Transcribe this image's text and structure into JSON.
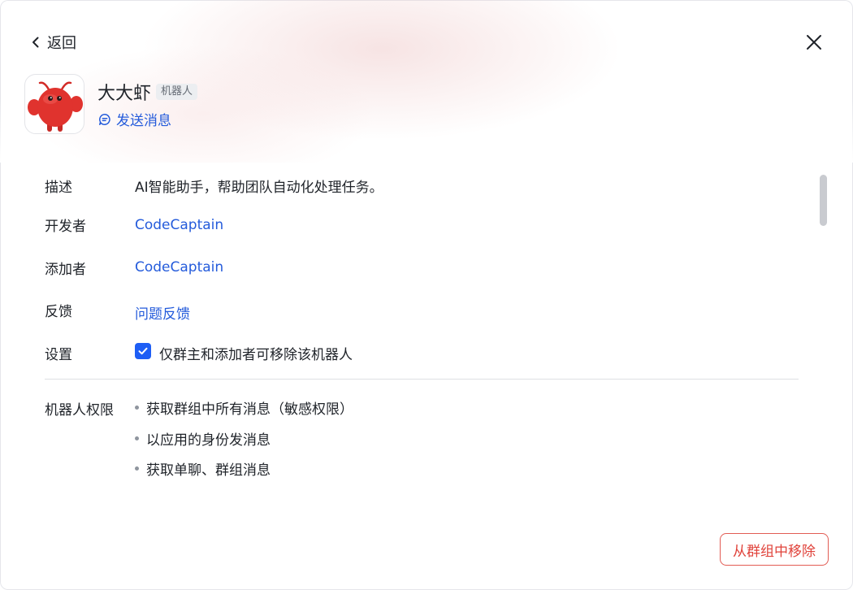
{
  "header": {
    "back_label": "返回",
    "bot_name": "大大虾",
    "bot_tag": "机器人",
    "send_message_label": "发送消息"
  },
  "details": {
    "description_label": "描述",
    "description_value": "AI智能助手，帮助团队自动化处理任务。",
    "developer_label": "开发者",
    "developer_value": "CodeCaptain",
    "adder_label": "添加者",
    "adder_value": "CodeCaptain",
    "feedback_label": "反馈",
    "feedback_value": "问题反馈",
    "settings_label": "设置",
    "settings_option": "仅群主和添加者可移除该机器人",
    "settings_checked": true
  },
  "permissions": {
    "label": "机器人权限",
    "items": [
      "获取群组中所有消息（敏感权限）",
      "以应用的身份发消息",
      "获取单聊、群组消息"
    ]
  },
  "footer": {
    "remove_button_label": "从群组中移除"
  },
  "colors": {
    "link": "#245bdb",
    "checkbox": "#1e5ef5",
    "danger": "#e0433b",
    "avatar_body": "#e0332e"
  }
}
